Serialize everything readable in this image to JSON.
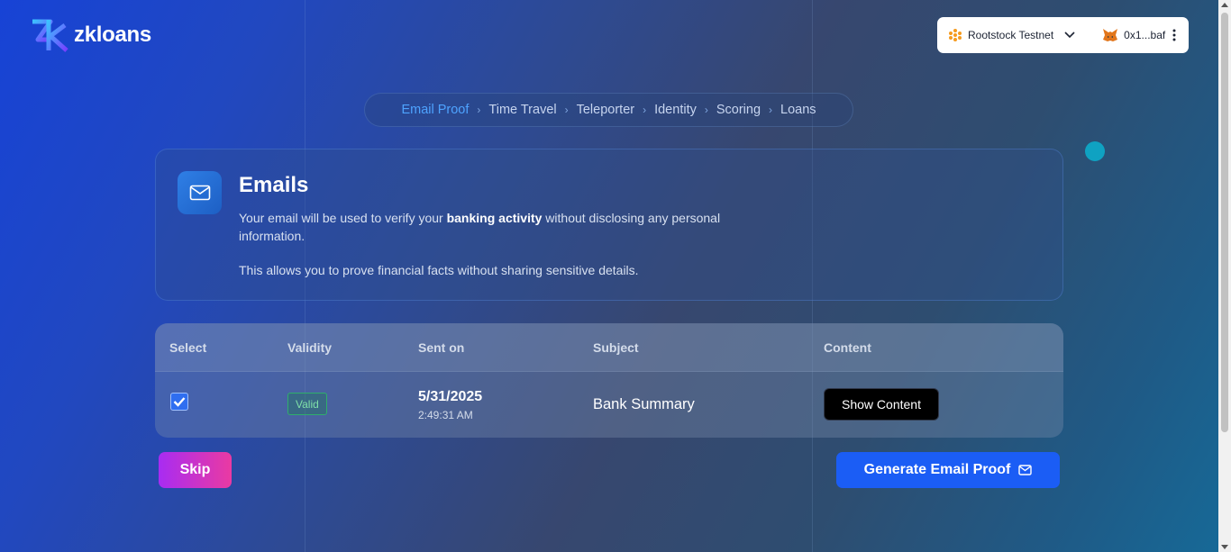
{
  "brand": {
    "name": "zkloans"
  },
  "wallet": {
    "network": "Rootstock Testnet",
    "account": "0x1...baf"
  },
  "steps": [
    {
      "label": "Email Proof",
      "active": true
    },
    {
      "label": "Time Travel"
    },
    {
      "label": "Teleporter"
    },
    {
      "label": "Identity"
    },
    {
      "label": "Scoring"
    },
    {
      "label": "Loans"
    }
  ],
  "emails_card": {
    "title": "Emails",
    "desc_prefix": "Your email will be used to verify your ",
    "desc_bold": "banking activity",
    "desc_suffix": " without disclosing any personal information.",
    "note": "This allows you to prove financial facts without sharing sensitive details."
  },
  "table": {
    "headers": [
      "Select",
      "Validity",
      "Sent on",
      "Subject",
      "Content"
    ],
    "rows": [
      {
        "checked": true,
        "validity": "Valid",
        "date": "5/31/2025",
        "time": "2:49:31 AM",
        "subject": "Bank Summary",
        "action": "Show Content"
      }
    ]
  },
  "actions": {
    "skip": "Skip",
    "generate": "Generate Email Proof"
  },
  "colors": {
    "accent": "#1b5df5",
    "active_step": "#4ea3ff",
    "valid": "#2fae6c",
    "skip_start": "#a82cf2",
    "skip_end": "#ea3aa2"
  }
}
